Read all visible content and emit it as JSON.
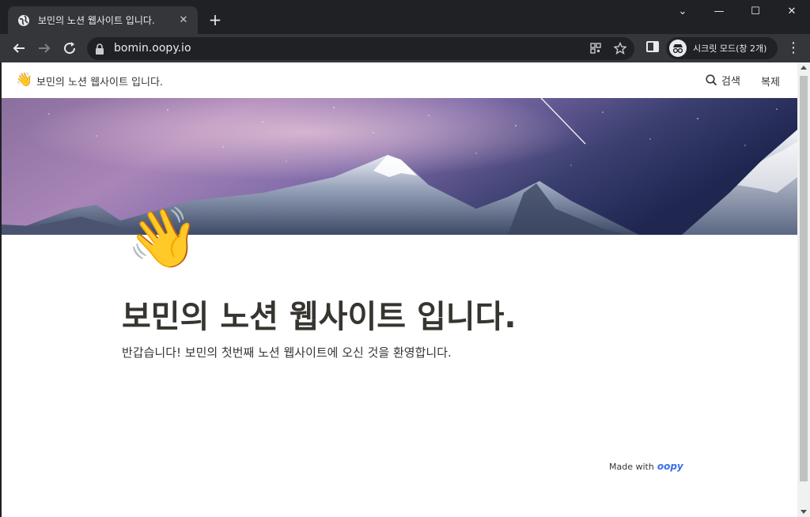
{
  "browser": {
    "tab_title": "보민의 노션 웹사이트 입니다.",
    "tab_close": "✕",
    "new_tab": "+",
    "window_controls": {
      "chevron": "⌄",
      "minimize": "—",
      "maximize": "☐",
      "close": "✕"
    },
    "url": "bomin.oopy.io",
    "incognito_label": "시크릿 모드(창 2개)",
    "icons": [
      "globe-icon",
      "back-arrow-icon",
      "forward-arrow-icon",
      "reload-icon",
      "lock-icon",
      "qr-code-icon",
      "star-icon",
      "side-panel-icon",
      "incognito-icon",
      "kebab-menu-icon"
    ]
  },
  "page": {
    "header_emoji": "👋",
    "header_title": "보민의 노션 웹사이트 입니다.",
    "search_label": "검색",
    "duplicate_label": "복제",
    "page_emoji": "👋",
    "heading": "보민의 노션 웹사이트 입니다.",
    "subtitle": "반갑습니다! 보민의 첫번째 노션 웹사이트에 오신 것을 환영합니다.",
    "made_with": "Made with",
    "brand": "oopy"
  },
  "colors": {
    "chrome_dark": "#202124",
    "chrome_toolbar": "#35363a",
    "text_primary": "#37352f",
    "brand_blue": "#3a6fe8"
  }
}
